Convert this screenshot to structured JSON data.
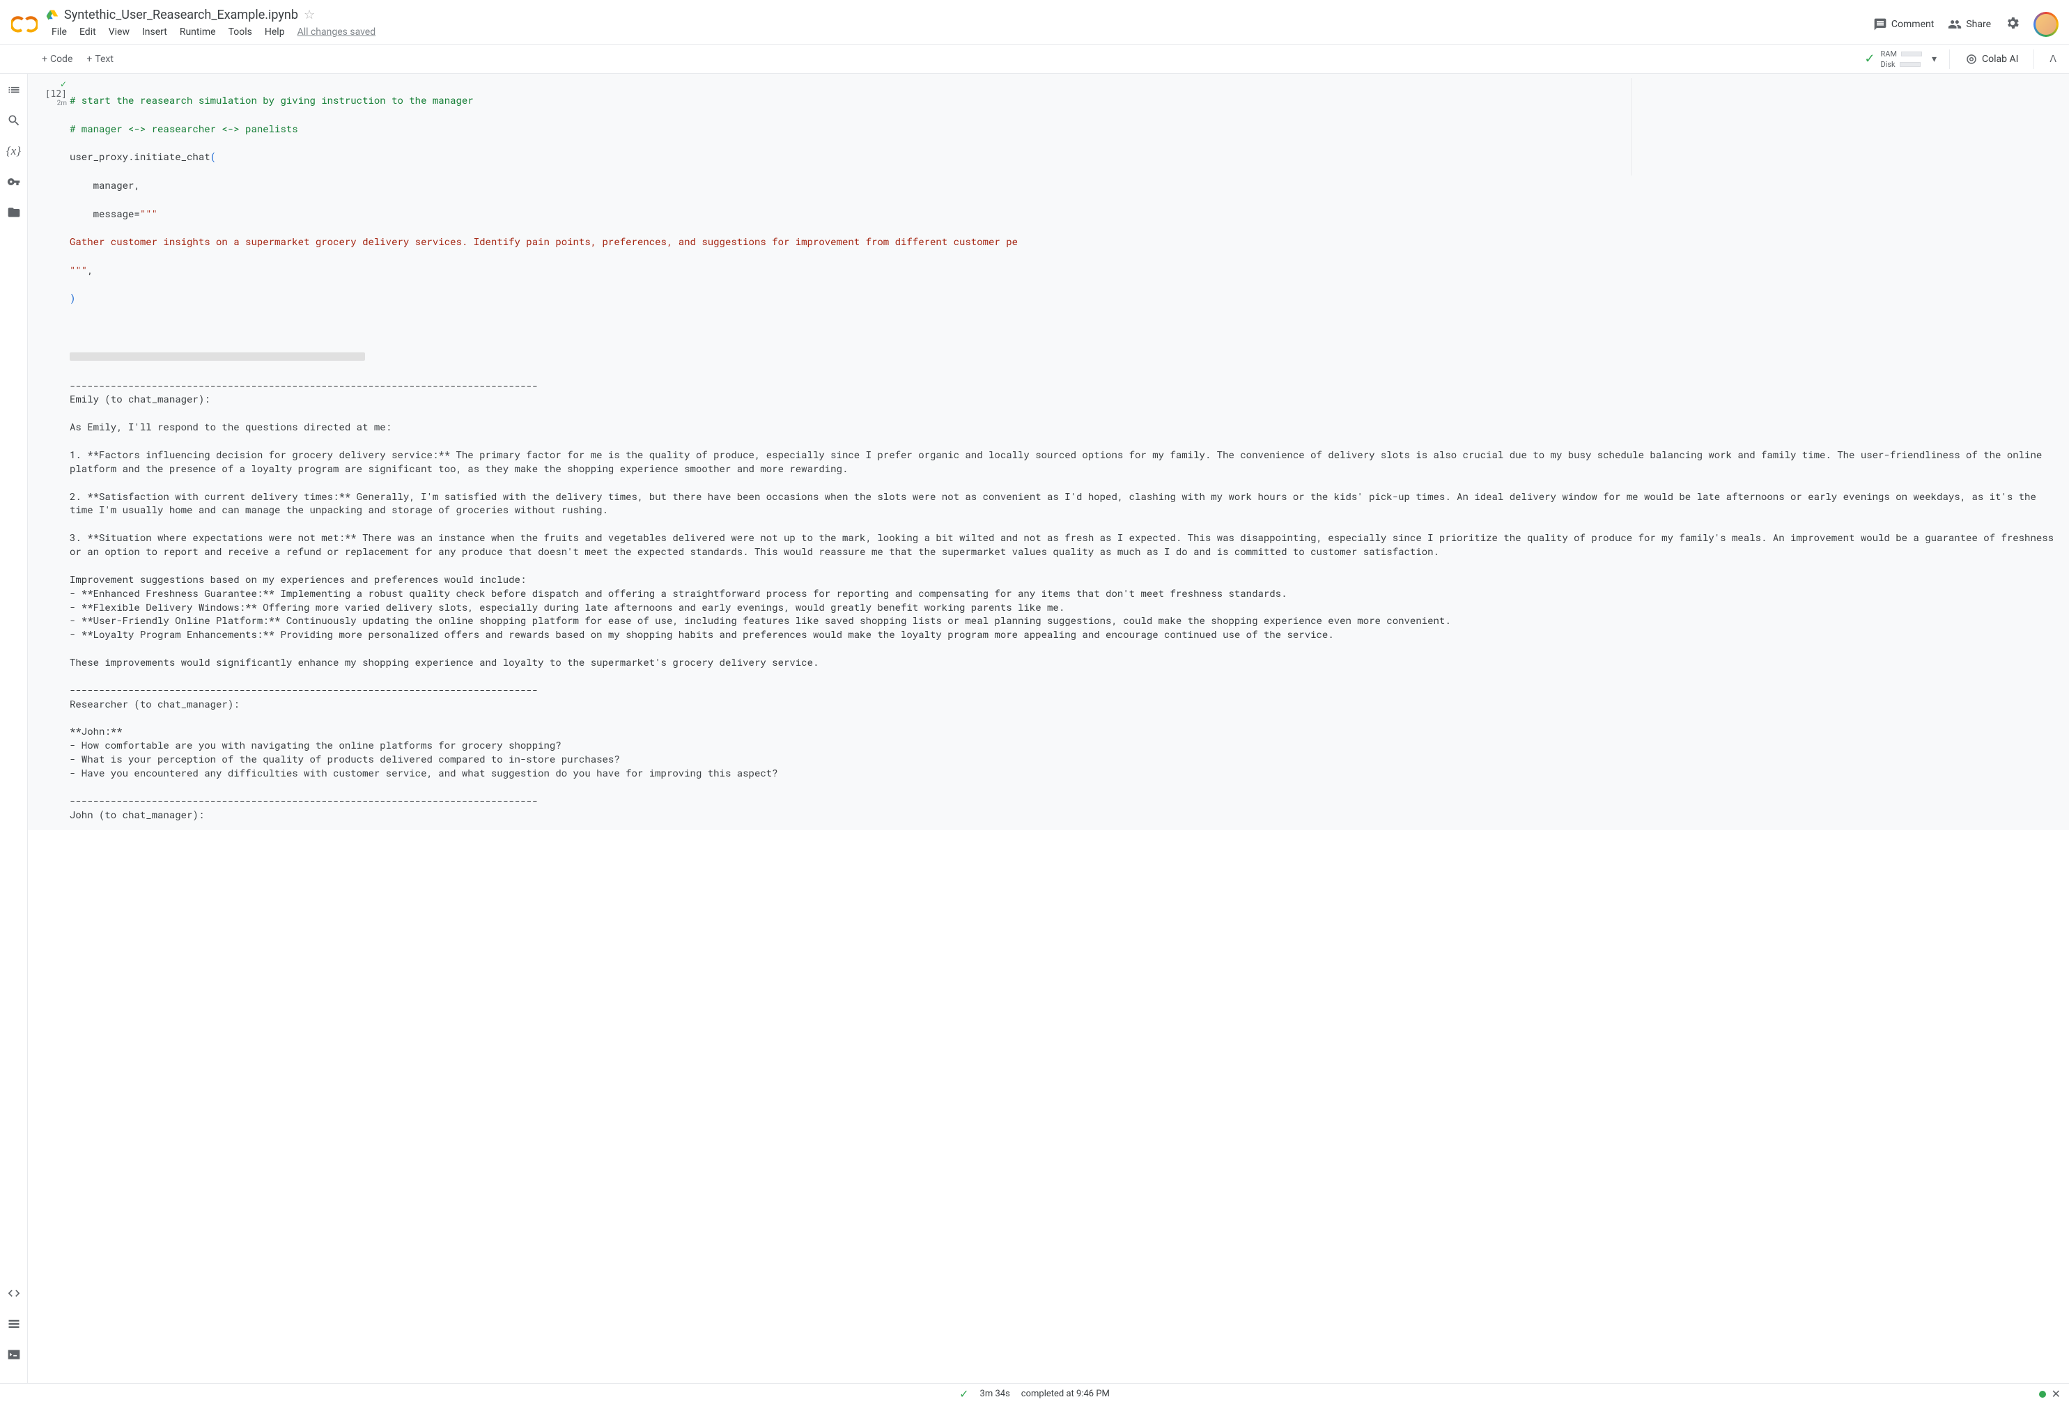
{
  "filename": "Syntethic_User_Reasearch_Example.ipynb",
  "menu": [
    "File",
    "Edit",
    "View",
    "Insert",
    "Runtime",
    "Tools",
    "Help"
  ],
  "saved_label": "All changes saved",
  "header_actions": {
    "comment": "Comment",
    "share": "Share"
  },
  "toolbar": {
    "code": "Code",
    "text": "Text",
    "ram": "RAM",
    "disk": "Disk",
    "colab_ai": "Colab AI"
  },
  "cell": {
    "exec_count": "[12]",
    "exec_time": "2m",
    "code_lines": {
      "l1": "# start the reasearch simulation by giving instruction to the manager",
      "l2": "# manager <-> reasearcher <-> panelists",
      "l3a": "user_proxy.initiate_chat",
      "l3b": "(",
      "l4": "    manager,",
      "l5a": "    message=",
      "l5b": "\"\"\"",
      "l6": "Gather customer insights on a supermarket grocery delivery services. Identify pain points, preferences, and suggestions for improvement from different customer pe",
      "l7a": "\"\"\"",
      "l7b": ",",
      "l8": ")"
    },
    "output": "\n--------------------------------------------------------------------------------\nEmily (to chat_manager):\n\nAs Emily, I'll respond to the questions directed at me:\n\n1. **Factors influencing decision for grocery delivery service:** The primary factor for me is the quality of produce, especially since I prefer organic and locally sourced options for my family. The convenience of delivery slots is also crucial due to my busy schedule balancing work and family time. The user-friendliness of the online platform and the presence of a loyalty program are significant too, as they make the shopping experience smoother and more rewarding.\n\n2. **Satisfaction with current delivery times:** Generally, I'm satisfied with the delivery times, but there have been occasions when the slots were not as convenient as I'd hoped, clashing with my work hours or the kids' pick-up times. An ideal delivery window for me would be late afternoons or early evenings on weekdays, as it's the time I'm usually home and can manage the unpacking and storage of groceries without rushing.\n\n3. **Situation where expectations were not met:** There was an instance when the fruits and vegetables delivered were not up to the mark, looking a bit wilted and not as fresh as I expected. This was disappointing, especially since I prioritize the quality of produce for my family's meals. An improvement would be a guarantee of freshness or an option to report and receive a refund or replacement for any produce that doesn't meet the expected standards. This would reassure me that the supermarket values quality as much as I do and is committed to customer satisfaction.\n\nImprovement suggestions based on my experiences and preferences would include:\n- **Enhanced Freshness Guarantee:** Implementing a robust quality check before dispatch and offering a straightforward process for reporting and compensating for any items that don't meet freshness standards.\n- **Flexible Delivery Windows:** Offering more varied delivery slots, especially during late afternoons and early evenings, would greatly benefit working parents like me.\n- **User-Friendly Online Platform:** Continuously updating the online shopping platform for ease of use, including features like saved shopping lists or meal planning suggestions, could make the shopping experience even more convenient.\n- **Loyalty Program Enhancements:** Providing more personalized offers and rewards based on my shopping habits and preferences would make the loyalty program more appealing and encourage continued use of the service.\n\nThese improvements would significantly enhance my shopping experience and loyalty to the supermarket's grocery delivery service.\n\n--------------------------------------------------------------------------------\nResearcher (to chat_manager):\n\n**John:**\n- How comfortable are you with navigating the online platforms for grocery shopping?\n- What is your perception of the quality of products delivered compared to in-store purchases?\n- Have you encountered any difficulties with customer service, and what suggestion do you have for improving this aspect?\n\n--------------------------------------------------------------------------------\nJohn (to chat_manager):"
  },
  "footer": {
    "duration": "3m 34s",
    "completed": "completed at 9:46 PM"
  }
}
